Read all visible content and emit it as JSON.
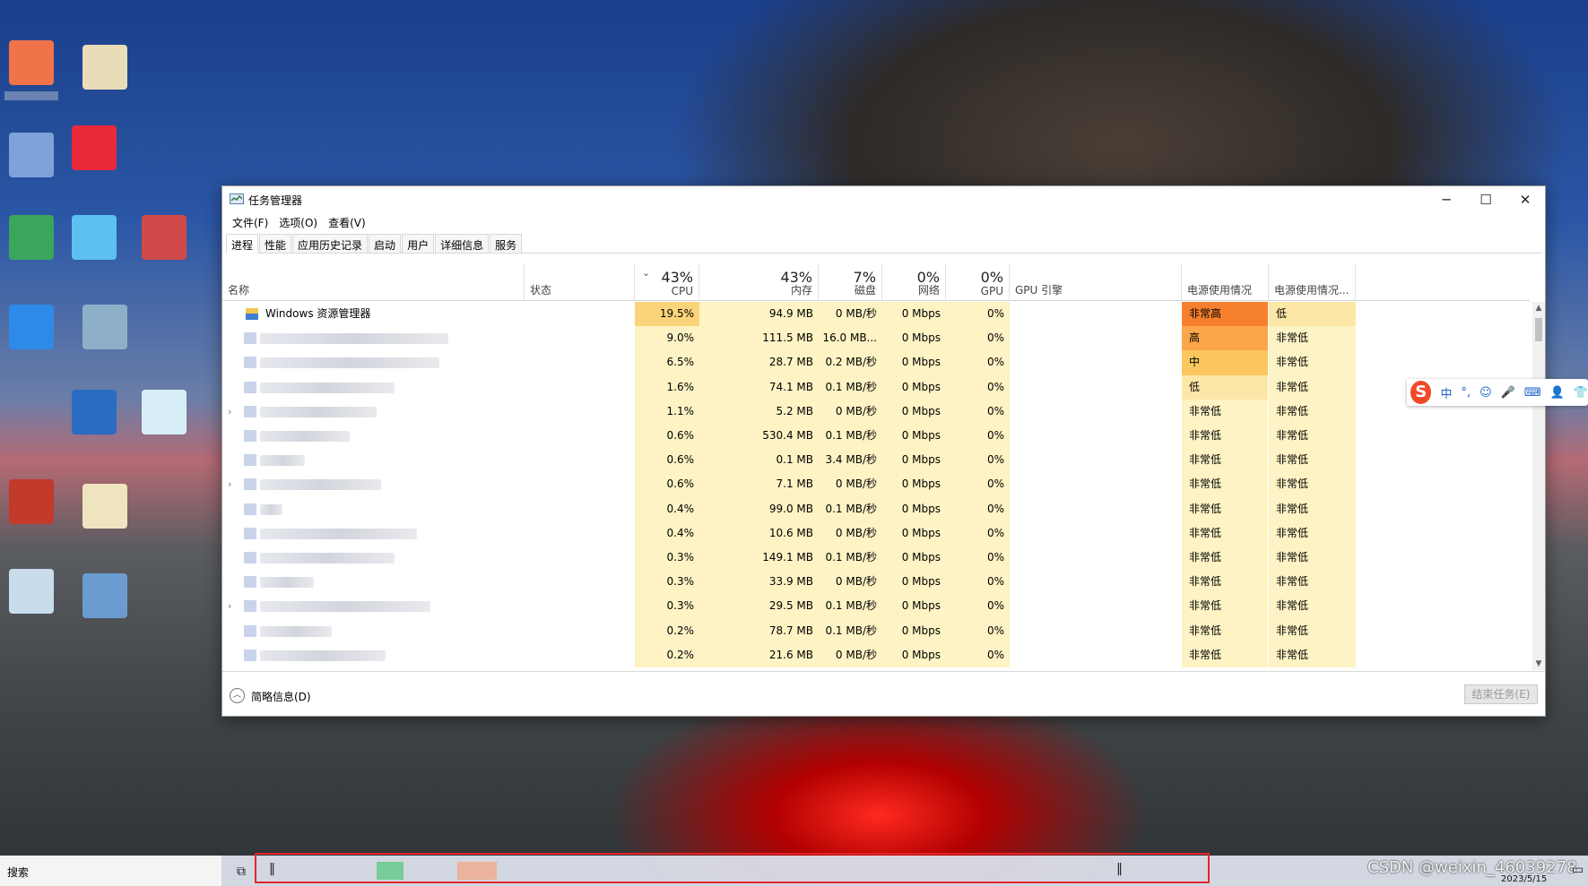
{
  "window": {
    "title": "任务管理器",
    "controls": {
      "minimize": "─",
      "maximize": "☐",
      "close": "✕"
    }
  },
  "menu": [
    "文件(F)",
    "选项(O)",
    "查看(V)"
  ],
  "tabs": [
    "进程",
    "性能",
    "应用历史记录",
    "启动",
    "用户",
    "详细信息",
    "服务"
  ],
  "columns": {
    "name": "名称",
    "status": "状态",
    "cpu": {
      "pct": "43%",
      "label": "CPU"
    },
    "memory": {
      "pct": "43%",
      "label": "内存"
    },
    "disk": {
      "pct": "7%",
      "label": "磁盘"
    },
    "network": {
      "pct": "0%",
      "label": "网络"
    },
    "gpu": {
      "pct": "0%",
      "label": "GPU"
    },
    "gpu_engine": "GPU 引擎",
    "power": "电源使用情况",
    "power_trend": "电源使用情况..."
  },
  "processes": [
    {
      "name": "Windows 资源管理器",
      "cpu": "19.5%",
      "mem": "94.9 MB",
      "disk": "0 MB/秒",
      "net": "0 Mbps",
      "gpu": "0%",
      "power": "非常高",
      "trend": "低"
    },
    {
      "name": "",
      "cpu": "9.0%",
      "mem": "111.5 MB",
      "disk": "16.0 MB...",
      "net": "0 Mbps",
      "gpu": "0%",
      "power": "高",
      "trend": "非常低"
    },
    {
      "name": "",
      "cpu": "6.5%",
      "mem": "28.7 MB",
      "disk": "0.2 MB/秒",
      "net": "0 Mbps",
      "gpu": "0%",
      "power": "中",
      "trend": "非常低"
    },
    {
      "name": "",
      "cpu": "1.6%",
      "mem": "74.1 MB",
      "disk": "0.1 MB/秒",
      "net": "0 Mbps",
      "gpu": "0%",
      "power": "低",
      "trend": "非常低"
    },
    {
      "name": "",
      "cpu": "1.1%",
      "mem": "5.2 MB",
      "disk": "0 MB/秒",
      "net": "0 Mbps",
      "gpu": "0%",
      "power": "非常低",
      "trend": "非常低"
    },
    {
      "name": "",
      "cpu": "0.6%",
      "mem": "530.4 MB",
      "disk": "0.1 MB/秒",
      "net": "0 Mbps",
      "gpu": "0%",
      "power": "非常低",
      "trend": "非常低"
    },
    {
      "name": "",
      "cpu": "0.6%",
      "mem": "0.1 MB",
      "disk": "3.4 MB/秒",
      "net": "0 Mbps",
      "gpu": "0%",
      "power": "非常低",
      "trend": "非常低"
    },
    {
      "name": "",
      "cpu": "0.6%",
      "mem": "7.1 MB",
      "disk": "0 MB/秒",
      "net": "0 Mbps",
      "gpu": "0%",
      "power": "非常低",
      "trend": "非常低"
    },
    {
      "name": "",
      "cpu": "0.4%",
      "mem": "99.0 MB",
      "disk": "0.1 MB/秒",
      "net": "0 Mbps",
      "gpu": "0%",
      "power": "非常低",
      "trend": "非常低"
    },
    {
      "name": "",
      "cpu": "0.4%",
      "mem": "10.6 MB",
      "disk": "0 MB/秒",
      "net": "0 Mbps",
      "gpu": "0%",
      "power": "非常低",
      "trend": "非常低"
    },
    {
      "name": "",
      "cpu": "0.3%",
      "mem": "149.1 MB",
      "disk": "0.1 MB/秒",
      "net": "0 Mbps",
      "gpu": "0%",
      "power": "非常低",
      "trend": "非常低"
    },
    {
      "name": "",
      "cpu": "0.3%",
      "mem": "33.9 MB",
      "disk": "0 MB/秒",
      "net": "0 Mbps",
      "gpu": "0%",
      "power": "非常低",
      "trend": "非常低"
    },
    {
      "name": "",
      "cpu": "0.3%",
      "mem": "29.5 MB",
      "disk": "0.1 MB/秒",
      "net": "0 Mbps",
      "gpu": "0%",
      "power": "非常低",
      "trend": "非常低"
    },
    {
      "name": "",
      "cpu": "0.2%",
      "mem": "78.7 MB",
      "disk": "0.1 MB/秒",
      "net": "0 Mbps",
      "gpu": "0%",
      "power": "非常低",
      "trend": "非常低"
    },
    {
      "name": "",
      "cpu": "0.2%",
      "mem": "21.6 MB",
      "disk": "0 MB/秒",
      "net": "0 Mbps",
      "gpu": "0%",
      "power": "非常低",
      "trend": "非常低"
    }
  ],
  "footer": {
    "fewer_details": "简略信息(D)",
    "end_task": "结束任务(E)"
  },
  "ime": {
    "logo": "S",
    "items": [
      "中",
      "°,",
      "☺",
      "🎤",
      "⌨",
      "👤",
      "👕"
    ]
  },
  "taskbar": {
    "search": "搜索",
    "watermark": "CSDN @weixin_46039278",
    "date": "2023/5/15"
  },
  "colors": {
    "cpu_heat": "#fbd47a",
    "col_heat": "#fdf3c4",
    "power_very_high": "#f7802e",
    "power_high": "#fba64a",
    "power_medium": "#fcc75e",
    "power_low": "#fde7a8",
    "highlight": "#e3262b"
  }
}
